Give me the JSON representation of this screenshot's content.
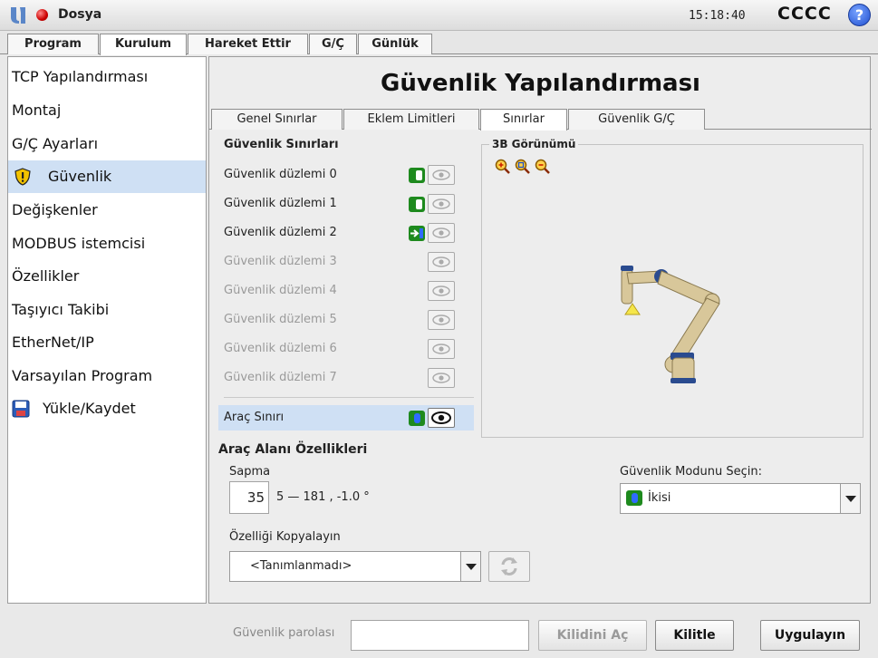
{
  "titlebar": {
    "logo_icon": "universal-robots-logo",
    "status_icon": "red-status-dot",
    "app_title": "Dosya",
    "time": "15:18:40",
    "robot_name": "CCCC",
    "help_label": "?"
  },
  "main_tabs": [
    {
      "label": "Program",
      "active": false
    },
    {
      "label": "Kurulum",
      "active": true
    },
    {
      "label": "Hareket Ettir",
      "active": false
    },
    {
      "label": "G/Ç",
      "active": false
    },
    {
      "label": "Günlük",
      "active": false
    }
  ],
  "sidebar": {
    "items": [
      {
        "label": "TCP Yapılandırması",
        "active": false
      },
      {
        "label": "Montaj",
        "active": false
      },
      {
        "label": "G/Ç Ayarları",
        "active": false
      },
      {
        "label": "Güvenlik",
        "active": true,
        "icon": "warning-shield-icon"
      },
      {
        "label": "Değişkenler",
        "active": false
      },
      {
        "label": "MODBUS istemcisi",
        "active": false
      },
      {
        "label": "Özellikler",
        "active": false
      },
      {
        "label": "Taşıyıcı Takibi",
        "active": false
      },
      {
        "label": "EtherNet/IP",
        "active": false
      },
      {
        "label": "Varsayılan Program",
        "active": false
      },
      {
        "label": "Yükle/Kaydet",
        "active": false,
        "icon": "save-disk-icon"
      }
    ]
  },
  "main": {
    "title": "Güvenlik Yapılandırması",
    "sub_tabs": [
      {
        "label": "Genel Sınırlar",
        "active": false
      },
      {
        "label": "Eklem Limitleri",
        "active": false
      },
      {
        "label": "Sınırlar",
        "active": true
      },
      {
        "label": "Güvenlik G/Ç",
        "active": false
      }
    ],
    "limits_section_title": "Güvenlik Sınırları",
    "planes": [
      {
        "label": "Güvenlik düzlemi 0",
        "enabled": true,
        "toggle": "green"
      },
      {
        "label": "Güvenlik düzlemi 1",
        "enabled": true,
        "toggle": "green"
      },
      {
        "label": "Güvenlik düzlemi 2",
        "enabled": true,
        "toggle": "arrow"
      },
      {
        "label": "Güvenlik düzlemi 3",
        "enabled": false,
        "toggle": "none"
      },
      {
        "label": "Güvenlik düzlemi 4",
        "enabled": false,
        "toggle": "none"
      },
      {
        "label": "Güvenlik düzlemi 5",
        "enabled": false,
        "toggle": "none"
      },
      {
        "label": "Güvenlik düzlemi 6",
        "enabled": false,
        "toggle": "none"
      },
      {
        "label": "Güvenlik düzlemi 7",
        "enabled": false,
        "toggle": "none"
      }
    ],
    "tool_limit": {
      "label": "Araç Sınırı",
      "toggle": "blue",
      "selected": true
    },
    "view3d_title": "3B Görünümü",
    "zoom_icons": [
      "zoom-in-icon",
      "zoom-fit-icon",
      "zoom-out-icon"
    ],
    "tool_props_title": "Araç Alanı Özellikleri",
    "deviation_label": "Sapma",
    "deviation_value": "35",
    "deviation_range": "5 — 181 , -1.0 °",
    "mode_label": "Güvenlik Modunu Seçin:",
    "mode_value": "İkisi",
    "copy_label": "Özelliği Kopyalayın",
    "copy_value": "<Tanımlanmadı>",
    "refresh_icon": "refresh-icon"
  },
  "footer": {
    "password_label": "Güvenlik parolası",
    "password_value": "",
    "unlock_label": "Kilidini Aç",
    "lock_label": "Kilitle",
    "apply_label": "Uygulayın"
  },
  "colors": {
    "selection": "#cfe0f4",
    "toggle_green": "#1e8a1e",
    "toggle_blue": "#2f6bff",
    "robot_body": "#d8c79a",
    "robot_joint": "#2a4b8f"
  }
}
